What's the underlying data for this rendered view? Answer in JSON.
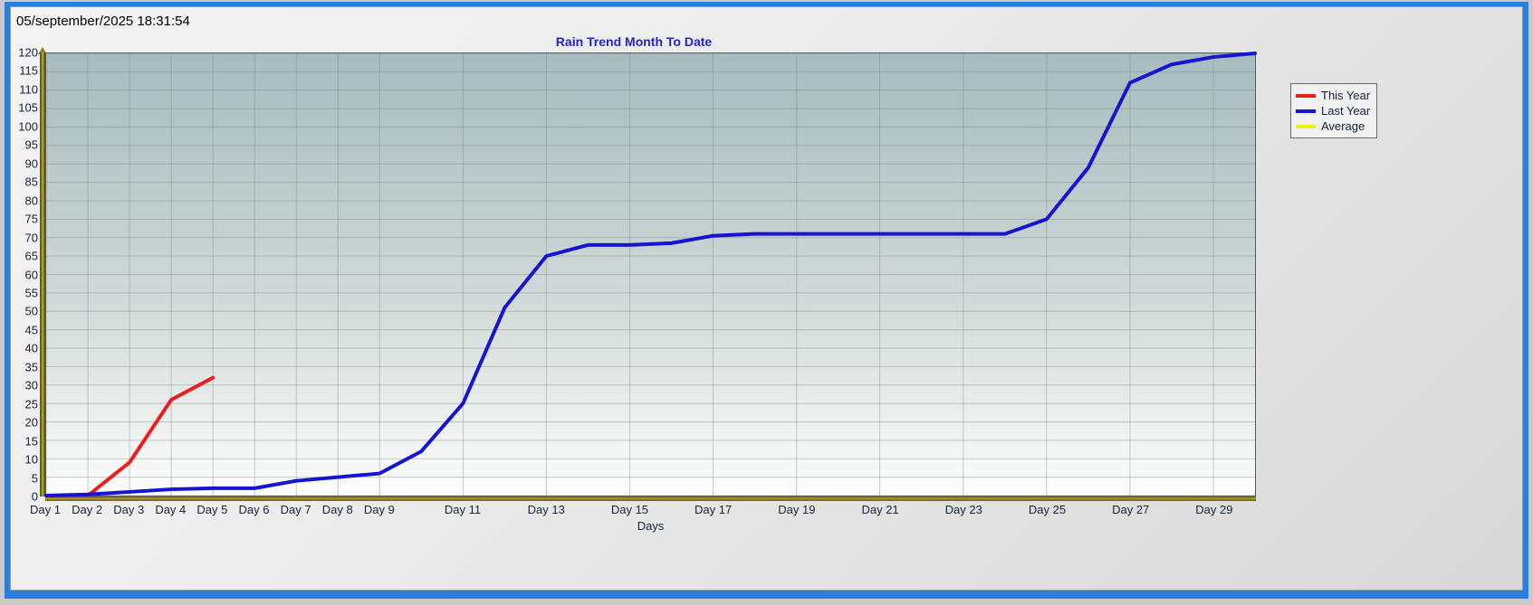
{
  "window": {
    "timestamp": "05/september/2025 18:31:54"
  },
  "chart_data": {
    "type": "line",
    "title": "Rain Trend Month To Date",
    "xlabel": "Days",
    "ylabel": "",
    "ylim": [
      0,
      120
    ],
    "ytick_step": 5,
    "yticks": [
      120,
      115,
      110,
      105,
      100,
      95,
      90,
      85,
      80,
      75,
      70,
      65,
      60,
      55,
      50,
      45,
      40,
      35,
      30,
      25,
      20,
      15,
      10,
      5,
      0
    ],
    "x": [
      1,
      2,
      3,
      4,
      5,
      6,
      7,
      8,
      9,
      10,
      11,
      12,
      13,
      14,
      15,
      16,
      17,
      18,
      19,
      20,
      21,
      22,
      23,
      24,
      25,
      26,
      27,
      28,
      29,
      30
    ],
    "categories": [
      "Day 1",
      "Day 2",
      "Day 3",
      "Day 4",
      "Day 5",
      "Day 6",
      "Day 7",
      "Day 8",
      "Day 9",
      "Day 10",
      "Day 11",
      "Day 12",
      "Day 13",
      "Day 14",
      "Day 15",
      "Day 16",
      "Day 17",
      "Day 18",
      "Day 19",
      "Day 20",
      "Day 21",
      "Day 22",
      "Day 23",
      "Day 24",
      "Day 25",
      "Day 26",
      "Day 27",
      "Day 28",
      "Day 29",
      "Day 30"
    ],
    "xtick_labels": [
      "Day 1",
      "Day 2",
      "Day 3",
      "Day 4",
      "Day 5",
      "Day 6",
      "Day 7",
      "Day 8",
      "Day 9",
      "Day 11",
      "Day 13",
      "Day 15",
      "Day 17",
      "Day 19",
      "Day 21",
      "Day 23",
      "Day 25",
      "Day 27",
      "Day 29"
    ],
    "xtick_values": [
      1,
      2,
      3,
      4,
      5,
      6,
      7,
      8,
      9,
      11,
      13,
      15,
      17,
      19,
      21,
      23,
      25,
      27,
      29
    ],
    "grid": true,
    "legend_position": "right",
    "series": [
      {
        "name": "This Year",
        "color": "#ee1c1c",
        "values": [
          0,
          0,
          9,
          26,
          32,
          null,
          null,
          null,
          null,
          null,
          null,
          null,
          null,
          null,
          null,
          null,
          null,
          null,
          null,
          null,
          null,
          null,
          null,
          null,
          null,
          null,
          null,
          null,
          null,
          null
        ]
      },
      {
        "name": "Last Year",
        "color": "#1414d2",
        "values": [
          0,
          0.3,
          1,
          1.7,
          2,
          2,
          4,
          5,
          6,
          12,
          25,
          51,
          65,
          68,
          68,
          68.5,
          70.5,
          71,
          71,
          71,
          71,
          71,
          71,
          71,
          75,
          89,
          112,
          117,
          119,
          120
        ]
      },
      {
        "name": "Average",
        "color": "#f2ee14",
        "values": [
          null,
          null,
          null,
          null,
          null,
          null,
          null,
          null,
          null,
          null,
          null,
          null,
          null,
          null,
          null,
          null,
          null,
          null,
          null,
          null,
          null,
          null,
          null,
          null,
          null,
          null,
          null,
          null,
          null,
          null
        ]
      }
    ]
  }
}
